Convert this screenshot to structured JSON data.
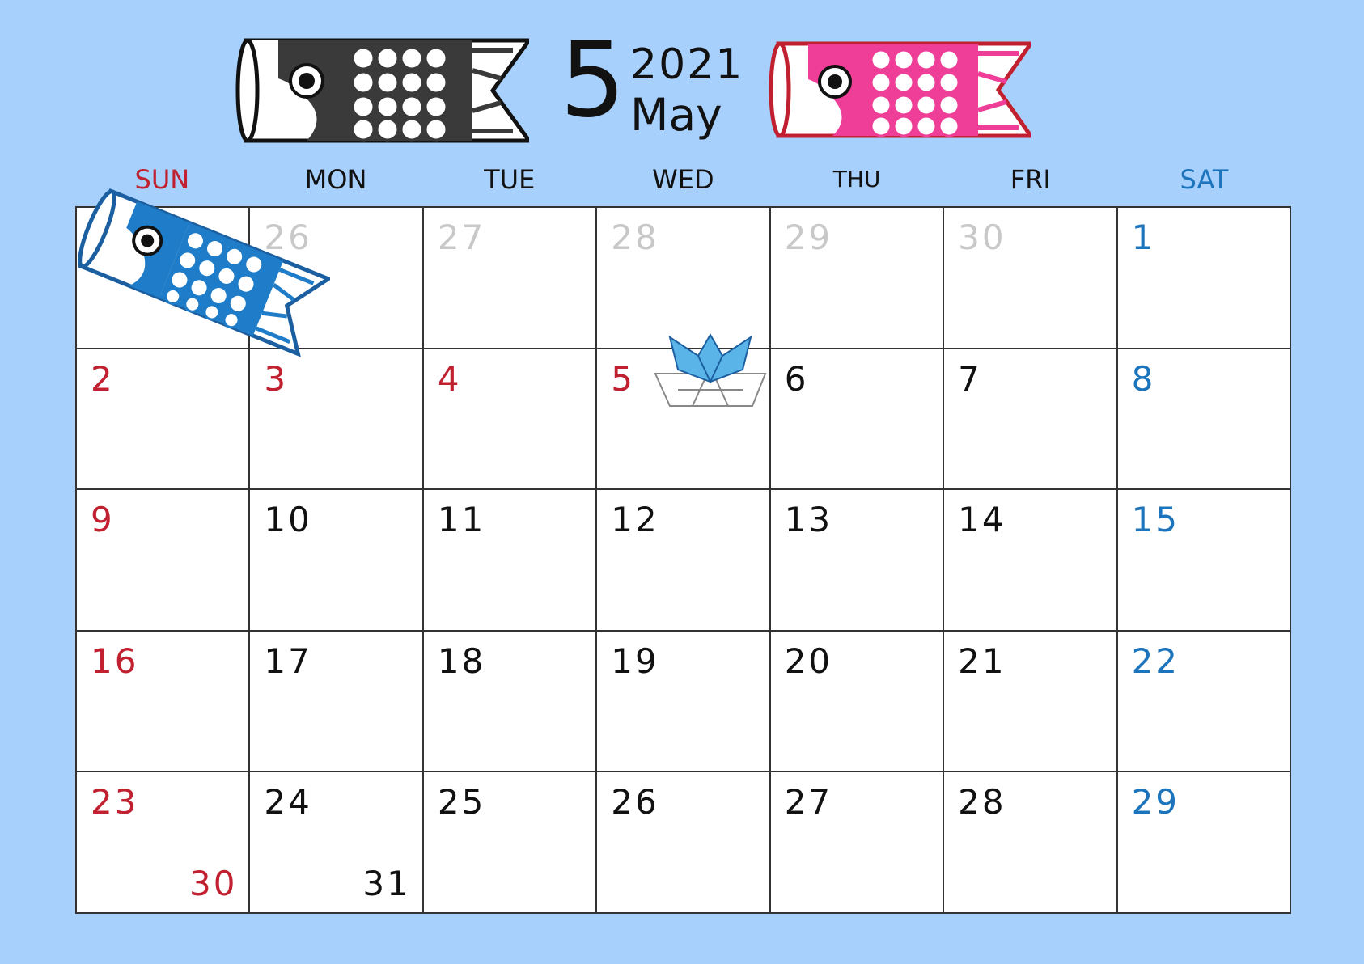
{
  "header": {
    "month_number": "5",
    "year": "2021",
    "month_name": "May"
  },
  "weekdays": [
    "SUN",
    "MON",
    "TUE",
    "WED",
    "THU",
    "FRI",
    "SAT"
  ],
  "weeks": [
    {
      "days": [
        "",
        "26",
        "27",
        "28",
        "29",
        "30",
        "1"
      ]
    },
    {
      "days": [
        "2",
        "3",
        "4",
        "5",
        "6",
        "7",
        "8"
      ]
    },
    {
      "days": [
        "9",
        "10",
        "11",
        "12",
        "13",
        "14",
        "15"
      ]
    },
    {
      "days": [
        "16",
        "17",
        "18",
        "19",
        "20",
        "21",
        "22"
      ]
    },
    {
      "days": [
        "23",
        "24",
        "25",
        "26",
        "27",
        "28",
        "29"
      ],
      "extra": [
        "30",
        "31"
      ]
    }
  ],
  "colors": {
    "background": "#a8d0fc",
    "sunday_holiday": "#c0202f",
    "saturday": "#1c74bd",
    "other_month": "#c8c8c8",
    "koi_black": "#3a3a3a",
    "koi_pink": "#ee3e97",
    "koi_blue": "#1e7cc8",
    "kabuto": "#5ab4e8"
  },
  "icons": [
    "koinobori-black-icon",
    "koinobori-pink-icon",
    "koinobori-blue-icon",
    "kabuto-origami-icon"
  ]
}
